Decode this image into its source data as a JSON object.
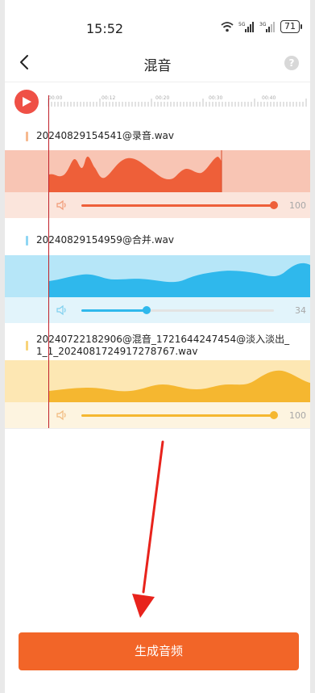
{
  "status_bar": {
    "time": "15:52",
    "battery": "71"
  },
  "header": {
    "title": "混音",
    "help_icon_text": "?"
  },
  "timeline": {
    "ticks": [
      "00:00",
      "00:12",
      "00:20",
      "00:30",
      "00:40"
    ]
  },
  "tracks": [
    {
      "name": "20240829154541@录音.wav",
      "volume": "100",
      "volume_level": 1.0,
      "color": "#ee5f39",
      "band_color": "#f8c5b4",
      "vol_band_color": "#fbe5dc",
      "marker_color": "#f6b98f"
    },
    {
      "name": "20240829154959@合并.wav",
      "volume": "34",
      "volume_level": 0.34,
      "color": "#2fb8ec",
      "band_color": "#b6e6f8",
      "vol_band_color": "#e2f4fb",
      "marker_color": "#8fd6f3"
    },
    {
      "name": "20240722182906@混音_1721644247454@淡入淡出_1_1_2024081724917278767.wav",
      "volume": "100",
      "volume_level": 1.0,
      "color": "#f5b730",
      "band_color": "#fde7b3",
      "vol_band_color": "#fdf4e0",
      "marker_color": "#f8d47a"
    }
  ],
  "footer": {
    "generate_label": "生成音频"
  },
  "colors": {
    "accent": "#f26528",
    "playhead": "#c0202a",
    "play_button": "#ef5046"
  }
}
